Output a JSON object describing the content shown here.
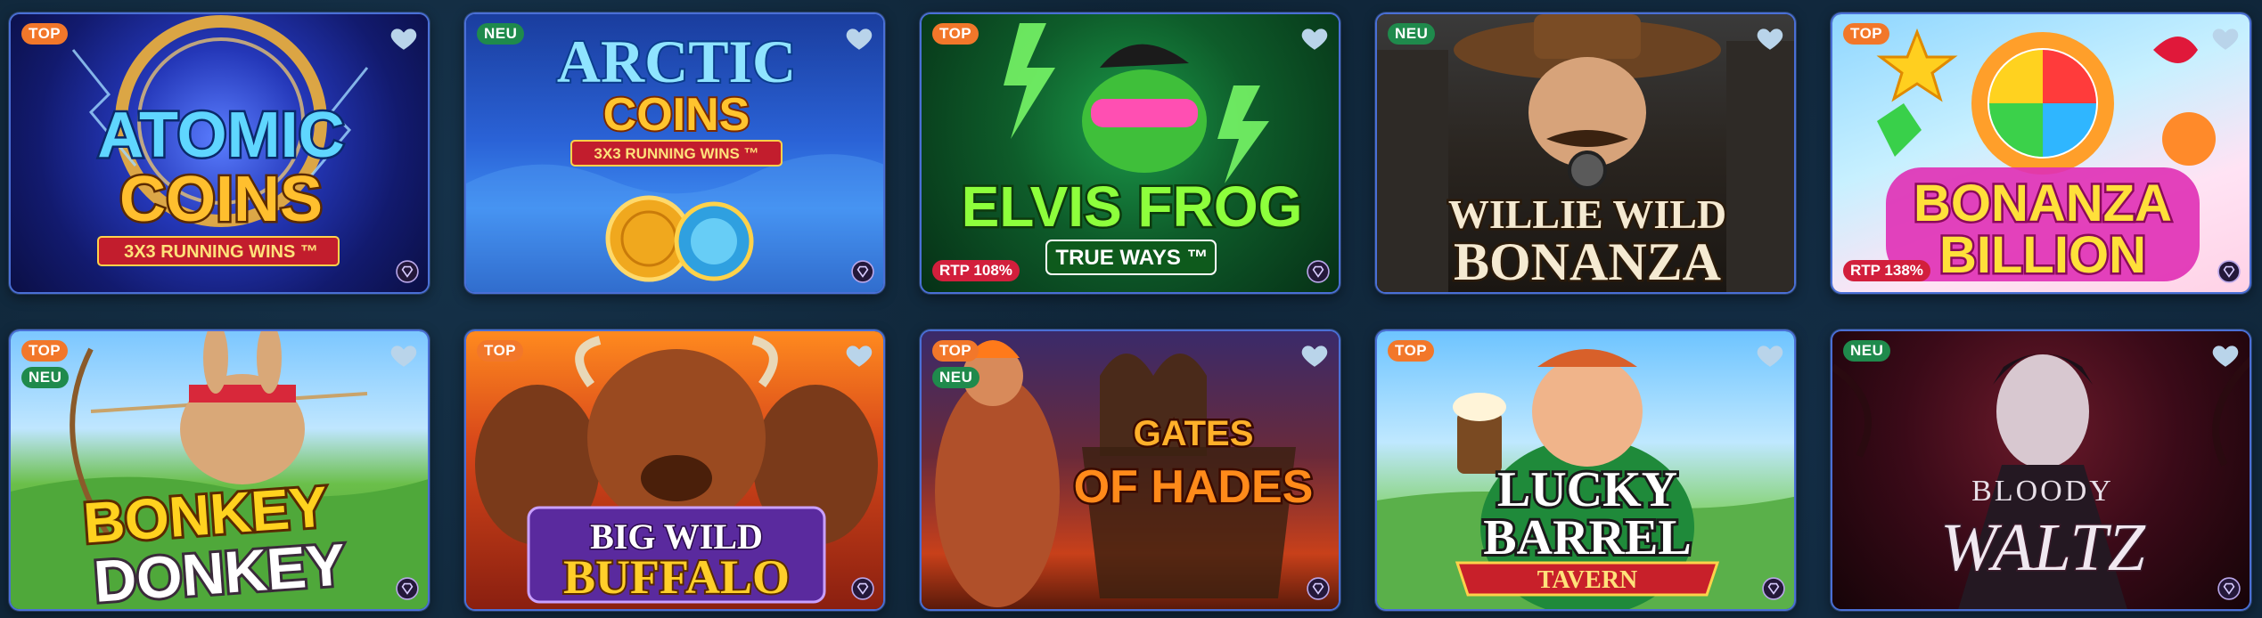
{
  "games": [
    {
      "title_line1": "ATOMIC",
      "title_line2": "COINS",
      "subtitle": "3X3 RUNNING WINS ™",
      "badges": [
        "TOP"
      ],
      "rtp": ""
    },
    {
      "title_line1": "ARCTIC",
      "title_line2": "COINS",
      "subtitle": "3X3 RUNNING WINS ™",
      "badges": [
        "NEU"
      ],
      "rtp": ""
    },
    {
      "title_line1": "ELVIS FROG",
      "title_line2": "",
      "subtitle": "TRUE WAYS ™",
      "badges": [
        "TOP"
      ],
      "rtp": "RTP 108%"
    },
    {
      "title_line1": "WILLIE WILD",
      "title_line2": "BONANZA",
      "subtitle": "",
      "badges": [
        "NEU"
      ],
      "rtp": ""
    },
    {
      "title_line1": "BONANZA",
      "title_line2": "BILLION",
      "subtitle": "",
      "badges": [
        "TOP"
      ],
      "rtp": "RTP 138%"
    },
    {
      "title_line1": "BONKEY",
      "title_line2": "DONKEY",
      "subtitle": "",
      "badges": [
        "TOP",
        "NEU"
      ],
      "rtp": ""
    },
    {
      "title_line1": "BIG WILD",
      "title_line2": "BUFFALO",
      "subtitle": "",
      "badges": [
        "TOP"
      ],
      "rtp": ""
    },
    {
      "title_line1": "GATES",
      "title_line2": "OF HADES",
      "subtitle": "",
      "badges": [
        "TOP",
        "NEU"
      ],
      "rtp": ""
    },
    {
      "title_line1": "LUCKY",
      "title_line2": "BARREL",
      "subtitle": "TAVERN",
      "badges": [
        "TOP"
      ],
      "rtp": ""
    },
    {
      "title_line1": "BLOODY",
      "title_line2": "WALTZ",
      "subtitle": "",
      "badges": [
        "NEU"
      ],
      "rtp": ""
    }
  ],
  "colors": {
    "top_badge": "#f2772a",
    "neu_badge": "#1f8a4c",
    "rtp_badge": "#d21f3c",
    "favorite_heart": "#b9d4ea",
    "tile_border": "#4a6fd6",
    "page_background": "#0f2436"
  },
  "icons": {
    "favorite": "heart-icon",
    "provider": "provider-diamond-icon"
  }
}
